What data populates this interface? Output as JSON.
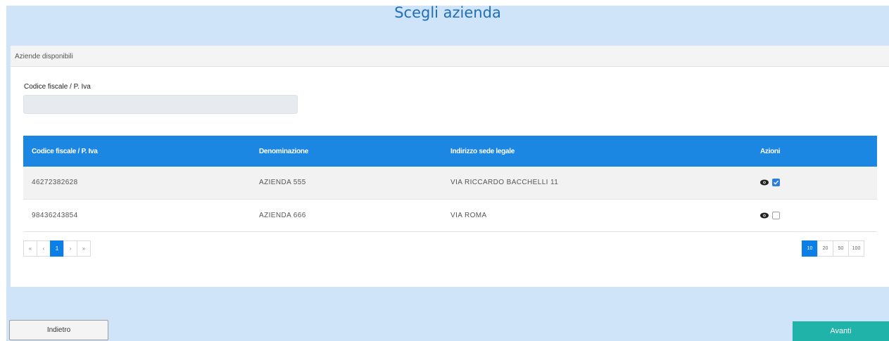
{
  "page": {
    "title": "Scegli azienda"
  },
  "card": {
    "header": "Aziende disponibili"
  },
  "filter": {
    "label": "Codice fiscale / P. Iva",
    "value": "",
    "placeholder": ""
  },
  "table": {
    "columns": [
      "Codice fiscale / P. Iva",
      "Denominazione",
      "Indirizzo sede legale",
      "Azioni"
    ],
    "rows": [
      {
        "cf": "46272382628",
        "denominazione": "AZIENDA 555",
        "indirizzo": "VIA RICCARDO BACCHELLI 11",
        "selected": true
      },
      {
        "cf": "98436243854",
        "denominazione": "AZIENDA 666",
        "indirizzo": "VIA ROMA",
        "selected": false
      }
    ]
  },
  "pagination": {
    "first": "«",
    "prev": "‹",
    "current": "1",
    "next": "›",
    "last": "»"
  },
  "page_sizes": {
    "s10": "10",
    "s20": "20",
    "s50": "50",
    "s100": "100",
    "active": "10"
  },
  "buttons": {
    "back": "Indietro",
    "next": "Avanti"
  },
  "colors": {
    "primary": "#1c86e3",
    "accent": "#1fb3aa",
    "background": "#cfe4f8"
  },
  "icons": {
    "view": "eye-icon",
    "select": "checkbox-icon"
  }
}
